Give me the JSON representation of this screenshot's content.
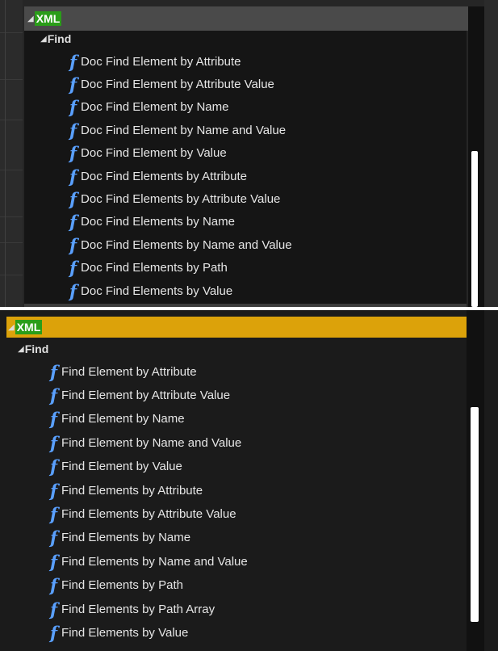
{
  "top_panel": {
    "header": "XML",
    "category": "Find",
    "items": [
      "Doc Find Element by Attribute",
      "Doc Find Element by Attribute Value",
      "Doc Find Element by Name",
      "Doc Find Element by Name and Value",
      "Doc Find Element by Value",
      "Doc Find Elements by Attribute",
      "Doc Find Elements by Attribute Value",
      "Doc Find Elements by Name",
      "Doc Find Elements by Name and Value",
      "Doc Find Elements by Path",
      "Doc Find Elements by Value"
    ]
  },
  "bottom_panel": {
    "header": "XML",
    "category": "Find",
    "items": [
      "Find Element by Attribute",
      "Find Element by Attribute Value",
      "Find Element by Name",
      "Find Element by Name and Value",
      "Find Element by Value",
      "Find Elements by Attribute",
      "Find Elements by Attribute Value",
      "Find Elements by Name",
      "Find Elements by Name and Value",
      "Find Elements by Path",
      "Find Elements by Path Array",
      "Find Elements by Value"
    ]
  },
  "icons": {
    "expand": "expanded-triangle-icon",
    "function": "function-f-icon"
  },
  "colors": {
    "xml_tag_bg": "#2a9d19",
    "selected_header_bg": "#dca20a",
    "function_icon": "#5aa0ff"
  }
}
